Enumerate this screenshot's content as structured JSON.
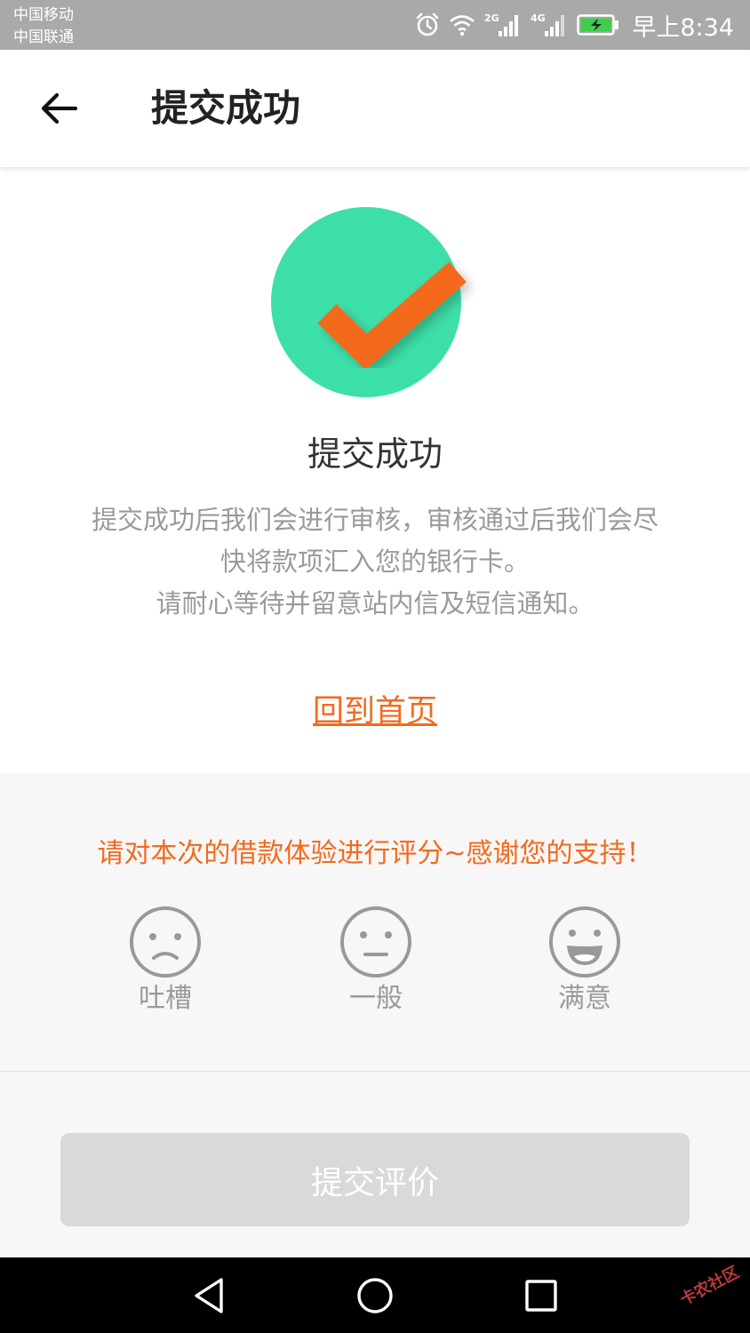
{
  "status_bar": {
    "carrier_1": "中国移动",
    "carrier_2": "中国联通",
    "network_1": "2G",
    "network_2": "4G",
    "time": "早上8:34",
    "icons": [
      "alarm-icon",
      "wifi-icon",
      "signal-2g-icon",
      "signal-4g-icon",
      "battery-charging-icon"
    ]
  },
  "app_bar": {
    "back_icon": "arrow-left-icon",
    "title": "提交成功"
  },
  "success": {
    "icon": "check-circle-icon",
    "title": "提交成功",
    "desc_line_1": "提交成功后我们会进行审核，审核通过后我们会尽",
    "desc_line_2": "快将款项汇入您的银行卡。",
    "desc_line_3": "请耐心等待并留意站内信及短信通知。",
    "home_link": "回到首页"
  },
  "rating": {
    "prompt": "请对本次的借款体验进行评分~感谢您的支持！",
    "options": [
      {
        "icon": "sad-face-icon",
        "label": "吐槽"
      },
      {
        "icon": "neutral-face-icon",
        "label": "一般"
      },
      {
        "icon": "happy-face-icon",
        "label": "满意"
      }
    ],
    "submit_label": "提交评价"
  },
  "nav_bar": {
    "icons": [
      "nav-back-icon",
      "nav-home-icon",
      "nav-recents-icon"
    ],
    "watermark": "卡农社区"
  },
  "colors": {
    "accent": "#f36a1e",
    "success_green": "#3ddfa8",
    "disabled_button": "#d9d9d9",
    "status_bar": "#a9a9a9"
  }
}
